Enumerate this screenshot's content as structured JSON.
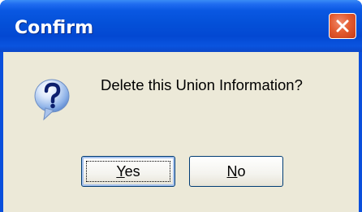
{
  "dialog": {
    "title": "Confirm",
    "message": "Delete this Union Information?",
    "icon": "question-icon",
    "close_icon": "close-icon"
  },
  "buttons": {
    "yes": {
      "mnemonic": "Y",
      "rest": "es",
      "is_default": true
    },
    "no": {
      "mnemonic": "N",
      "rest": "o",
      "is_default": false
    }
  },
  "colors": {
    "titlebar": "#0450d8",
    "client_background": "#ece9d8",
    "close_button": "#e35b30",
    "button_border": "#003c74"
  }
}
